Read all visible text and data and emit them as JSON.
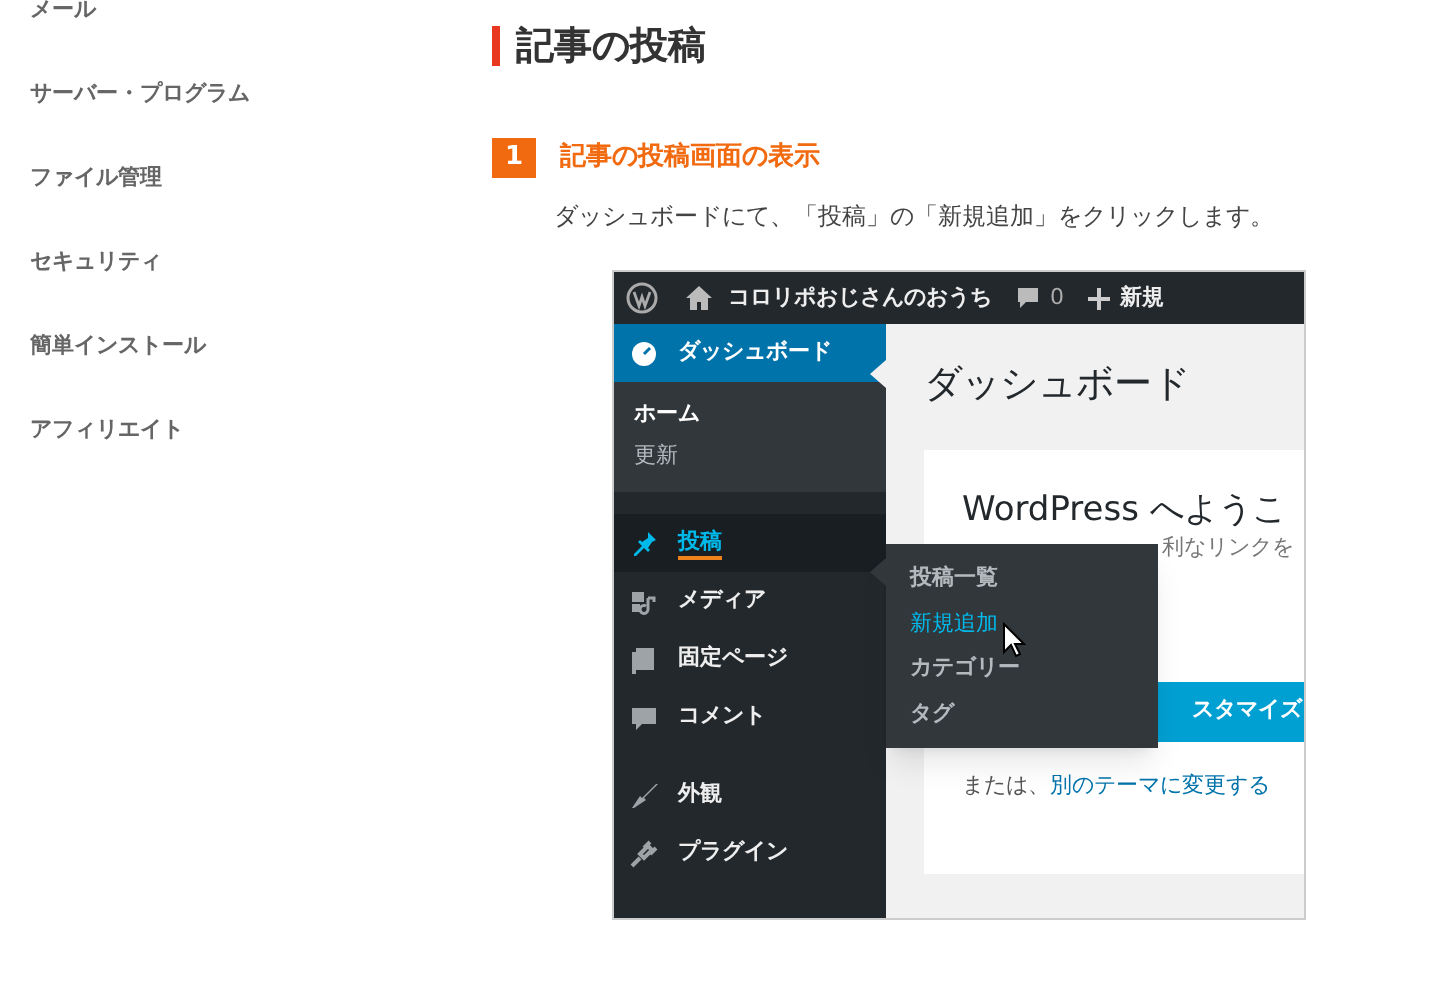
{
  "sidebar": {
    "items": [
      {
        "label": "メール"
      },
      {
        "label": "サーバー・プログラム"
      },
      {
        "label": "ファイル管理"
      },
      {
        "label": "セキュリティ"
      },
      {
        "label": "簡単インストール"
      },
      {
        "label": "アフィリエイト"
      }
    ]
  },
  "title": "記事の投稿",
  "step": {
    "number": "1",
    "title": "記事の投稿画面の表示",
    "text": "ダッシュボードにて、「投稿」の「新規追加」をクリックします。"
  },
  "screenshot": {
    "admin_bar": {
      "site": "コロリポおじさんのおうち",
      "comments": "0",
      "new": "新規"
    },
    "menu": [
      {
        "kind": "main",
        "label": "ダッシュボード",
        "selected": true
      },
      {
        "kind": "sub",
        "label": "ホーム",
        "selected": true
      },
      {
        "kind": "sub",
        "label": "更新",
        "selected": false
      },
      {
        "kind": "main",
        "label": "投稿",
        "selected": false,
        "hover": true
      },
      {
        "kind": "main",
        "label": "メディア",
        "selected": false
      },
      {
        "kind": "main",
        "label": "固定ページ",
        "selected": false
      },
      {
        "kind": "main",
        "label": "コメント",
        "selected": false
      },
      {
        "kind": "main",
        "label": "外観",
        "selected": false,
        "gap": true
      },
      {
        "kind": "main",
        "label": "プラグイン",
        "selected": false
      }
    ],
    "flyout": [
      {
        "label": "投稿一覧",
        "selected": false
      },
      {
        "label": "新規追加",
        "selected": true
      },
      {
        "label": "カテゴリー",
        "selected": false
      },
      {
        "label": "タグ",
        "selected": false
      }
    ],
    "heading": "ダッシュボード",
    "welcome": {
      "title": "WordPress へようこ",
      "subtitle": "利なリンクを",
      "button": "スタマイズ",
      "or_text": "または、",
      "link": "別のテーマに変更する"
    }
  }
}
